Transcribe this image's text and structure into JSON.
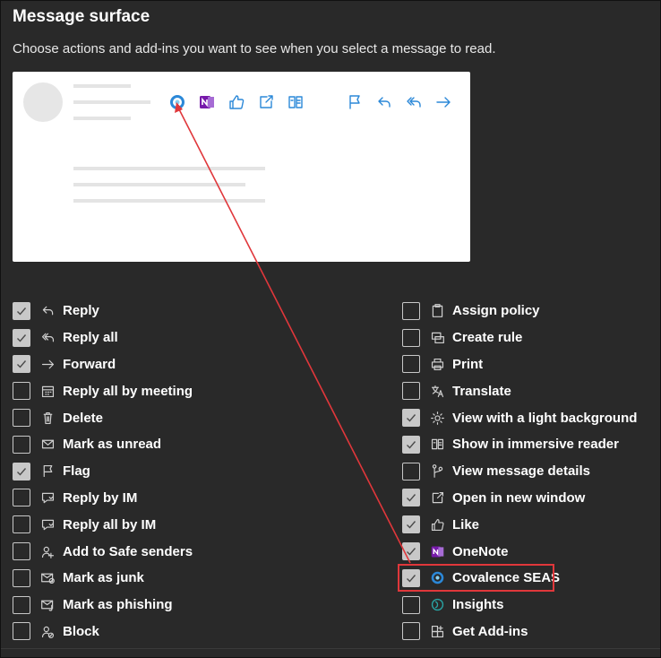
{
  "header": {
    "title": "Message surface",
    "subtitle": "Choose actions and add-ins you want to see when you select a message to read."
  },
  "colors": {
    "accent": "#2b88d8",
    "onenote": "#7719aa",
    "highlight": "#e0373b",
    "panel": "#292929"
  },
  "preview_toolbar": [
    "covalence-icon",
    "onenote-icon",
    "like-icon",
    "open-window-icon",
    "immersive-reader-icon",
    "light-background-icon",
    "flag-icon",
    "reply-icon",
    "reply-all-icon",
    "forward-icon"
  ],
  "left_items": [
    {
      "label": "Reply",
      "checked": true,
      "icon": "reply-icon"
    },
    {
      "label": "Reply all",
      "checked": true,
      "icon": "reply-all-icon"
    },
    {
      "label": "Forward",
      "checked": true,
      "icon": "forward-icon"
    },
    {
      "label": "Reply all by meeting",
      "checked": false,
      "icon": "calendar-icon"
    },
    {
      "label": "Delete",
      "checked": false,
      "icon": "trash-icon"
    },
    {
      "label": "Mark as unread",
      "checked": false,
      "icon": "mail-icon"
    },
    {
      "label": "Flag",
      "checked": true,
      "icon": "flag-icon"
    },
    {
      "label": "Reply by IM",
      "checked": false,
      "icon": "chat-icon"
    },
    {
      "label": "Reply all by IM",
      "checked": false,
      "icon": "chat-icon"
    },
    {
      "label": "Add to Safe senders",
      "checked": false,
      "icon": "person-add-icon"
    },
    {
      "label": "Mark as junk",
      "checked": false,
      "icon": "junk-icon"
    },
    {
      "label": "Mark as phishing",
      "checked": false,
      "icon": "phishing-icon"
    },
    {
      "label": "Block",
      "checked": false,
      "icon": "block-person-icon"
    }
  ],
  "right_items": [
    {
      "label": "Assign policy",
      "checked": false,
      "icon": "clipboard-icon"
    },
    {
      "label": "Create rule",
      "checked": false,
      "icon": "rule-icon"
    },
    {
      "label": "Print",
      "checked": false,
      "icon": "print-icon"
    },
    {
      "label": "Translate",
      "checked": false,
      "icon": "translate-icon"
    },
    {
      "label": "View with a light background",
      "checked": true,
      "icon": "sun-icon"
    },
    {
      "label": "Show in immersive reader",
      "checked": true,
      "icon": "immersive-reader-icon"
    },
    {
      "label": "View message details",
      "checked": false,
      "icon": "branch-icon"
    },
    {
      "label": "Open in new window",
      "checked": true,
      "icon": "open-window-icon"
    },
    {
      "label": "Like",
      "checked": true,
      "icon": "like-icon"
    },
    {
      "label": "OneNote",
      "checked": true,
      "icon": "onenote-icon"
    },
    {
      "label": "Covalence SEAS",
      "checked": true,
      "icon": "covalence-icon"
    },
    {
      "label": "Insights",
      "checked": false,
      "icon": "insights-icon"
    },
    {
      "label": "Get Add-ins",
      "checked": false,
      "icon": "add-ins-icon"
    }
  ]
}
